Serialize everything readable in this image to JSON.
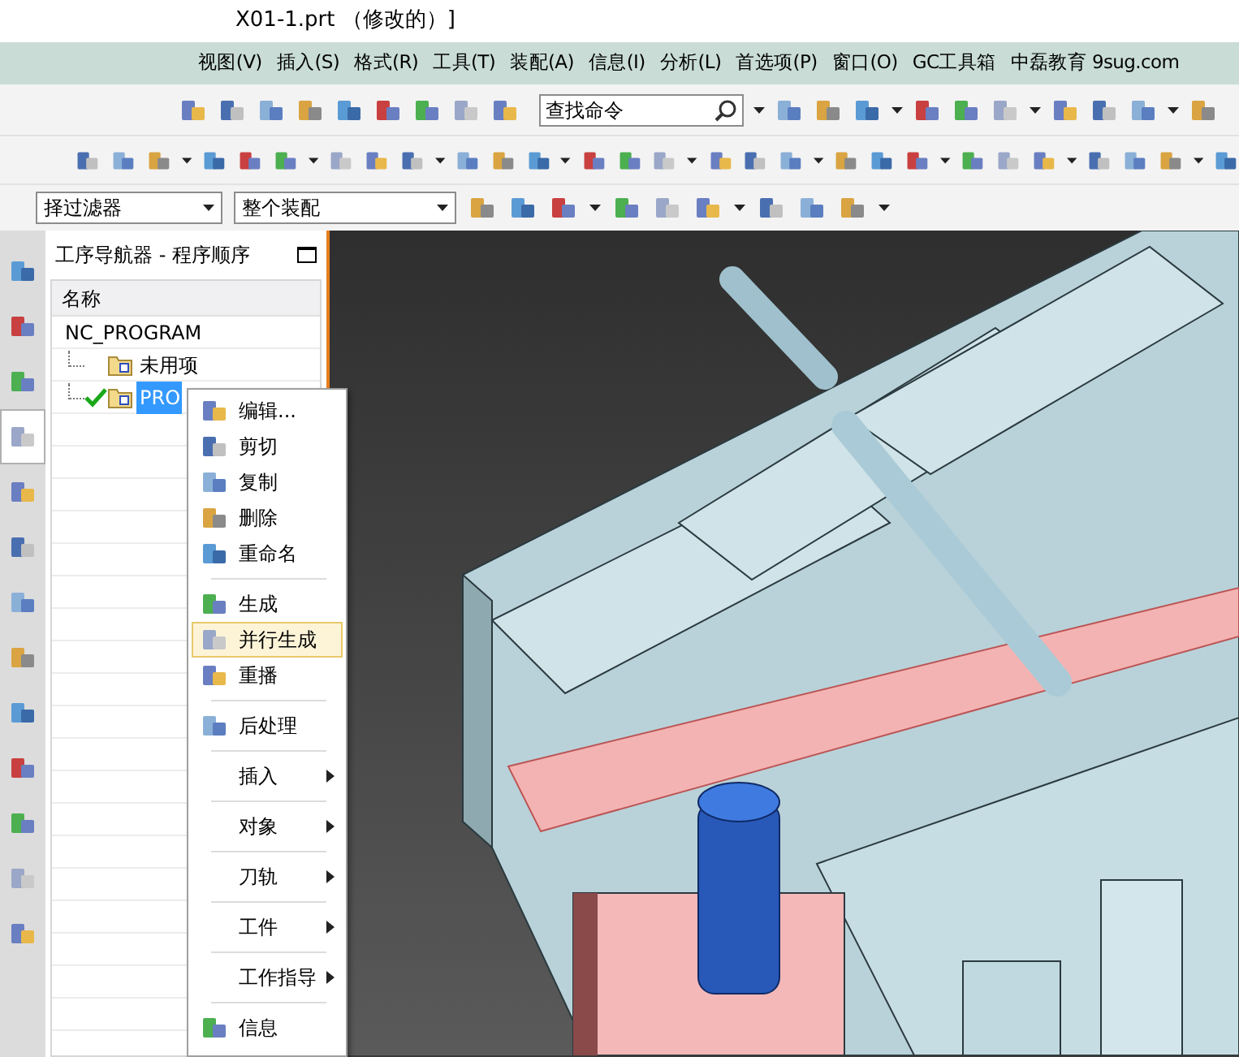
{
  "window": {
    "title": "X01-1.prt （修改的）]"
  },
  "menu_bar": [
    {
      "label": "视图(V)"
    },
    {
      "label": "插入(S)"
    },
    {
      "label": "格式(R)"
    },
    {
      "label": "工具(T)"
    },
    {
      "label": "装配(A)"
    },
    {
      "label": "信息(I)"
    },
    {
      "label": "分析(L)"
    },
    {
      "label": "首选项(P)"
    },
    {
      "label": "窗口(O)"
    },
    {
      "label": "GC工具箱"
    },
    {
      "label": "中磊教育 9sug.com"
    }
  ],
  "command_search": {
    "placeholder": "查找命令"
  },
  "filters": [
    {
      "value": "择过滤器"
    },
    {
      "value": "整个装配"
    }
  ],
  "side_tabs": [
    {
      "selected": false
    },
    {
      "selected": false
    },
    {
      "selected": false
    },
    {
      "selected": true
    },
    {
      "selected": false
    },
    {
      "selected": false
    },
    {
      "selected": false
    },
    {
      "selected": false
    },
    {
      "selected": false
    },
    {
      "selected": false
    },
    {
      "selected": false
    },
    {
      "selected": false
    },
    {
      "selected": false
    }
  ],
  "navigator": {
    "title": "工序导航器 - 程序顺序",
    "column": "名称",
    "tree": [
      {
        "label": "NC_PROGRAM",
        "children": [
          {
            "label": "未用项",
            "checked": false,
            "selected": false
          },
          {
            "label": "PRO",
            "checked": true,
            "selected": true
          }
        ]
      }
    ]
  },
  "context_menu": [
    {
      "kind": "command",
      "label": "编辑...",
      "selected": false
    },
    {
      "kind": "command",
      "label": "剪切",
      "selected": false
    },
    {
      "kind": "command",
      "label": "复制",
      "selected": false
    },
    {
      "kind": "command",
      "label": "删除",
      "selected": false
    },
    {
      "kind": "command",
      "label": "重命名",
      "selected": false
    },
    {
      "kind": "separator"
    },
    {
      "kind": "command",
      "label": "生成",
      "selected": false
    },
    {
      "kind": "command",
      "label": "并行生成",
      "selected": true
    },
    {
      "kind": "command",
      "label": "重播",
      "selected": false
    },
    {
      "kind": "separator"
    },
    {
      "kind": "command",
      "label": "后处理",
      "selected": false
    },
    {
      "kind": "separator"
    },
    {
      "kind": "submenu",
      "label": "插入",
      "selected": false
    },
    {
      "kind": "separator"
    },
    {
      "kind": "submenu",
      "label": "对象",
      "selected": false
    },
    {
      "kind": "separator"
    },
    {
      "kind": "submenu",
      "label": "刀轨",
      "selected": false
    },
    {
      "kind": "separator"
    },
    {
      "kind": "submenu",
      "label": "工件",
      "selected": false
    },
    {
      "kind": "separator"
    },
    {
      "kind": "submenu",
      "label": "工作指导",
      "selected": false
    },
    {
      "kind": "separator"
    },
    {
      "kind": "command",
      "label": "信息",
      "selected": false
    }
  ]
}
